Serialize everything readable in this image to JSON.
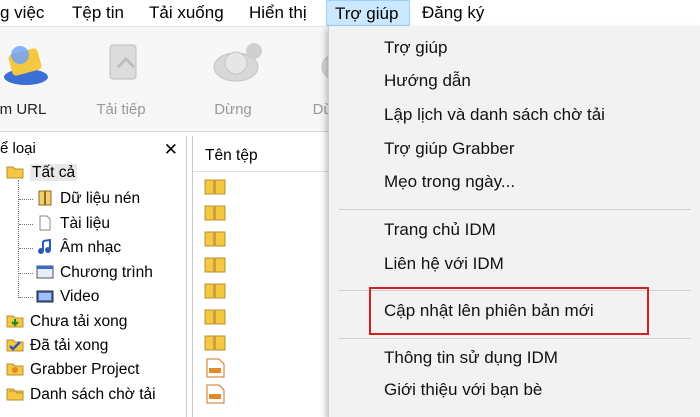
{
  "menubar": {
    "items": [
      "g việc",
      "Tệp tin",
      "Tải xuống",
      "Hiển thị",
      "Trợ giúp",
      "Đăng ký"
    ],
    "active_index": 4
  },
  "toolbar": {
    "buttons": [
      {
        "label": "m URL",
        "enabled": true
      },
      {
        "label": "Tải tiếp",
        "enabled": false
      },
      {
        "label": "Dừng",
        "enabled": false
      },
      {
        "label": "Dừ",
        "enabled": false
      }
    ]
  },
  "left_panel": {
    "header": "ể loại",
    "close_label": "✕",
    "tree": [
      {
        "label": "Tất cả",
        "icon": "folder-open-icon"
      },
      {
        "label": "Dữ liệu nén",
        "icon": "archive-icon"
      },
      {
        "label": "Tài liệu",
        "icon": "document-icon"
      },
      {
        "label": "Âm nhạc",
        "icon": "music-icon"
      },
      {
        "label": "Chương trình",
        "icon": "program-icon"
      },
      {
        "label": "Video",
        "icon": "video-icon"
      },
      {
        "label": "Chưa tải xong",
        "icon": "unfinished-folder-icon"
      },
      {
        "label": "Đã tải xong",
        "icon": "finished-folder-icon"
      },
      {
        "label": "Grabber Project",
        "icon": "grabber-folder-icon"
      },
      {
        "label": "Danh sách chờ tải",
        "icon": "queue-folder-icon"
      }
    ]
  },
  "file_list": {
    "column_header": "Tên tệp"
  },
  "dropdown": {
    "items": [
      "Trợ giúp",
      "Hướng dẫn",
      "Lập lịch và danh sách chờ tải",
      "Trợ giúp Grabber",
      "Mẹo trong ngày...",
      "Trang chủ IDM",
      "Liên hệ với IDM",
      "Cập nhật lên phiên bản mới",
      "Thông tin sử dụng IDM",
      "Giới thiệu với bạn bè"
    ],
    "highlighted_index": 7,
    "highlight_color": "#d02020"
  },
  "colors": {
    "menu_active_bg": "#cce8ff",
    "dropdown_bg": "#f2f2f2",
    "folder_yellow": "#f5c842"
  }
}
